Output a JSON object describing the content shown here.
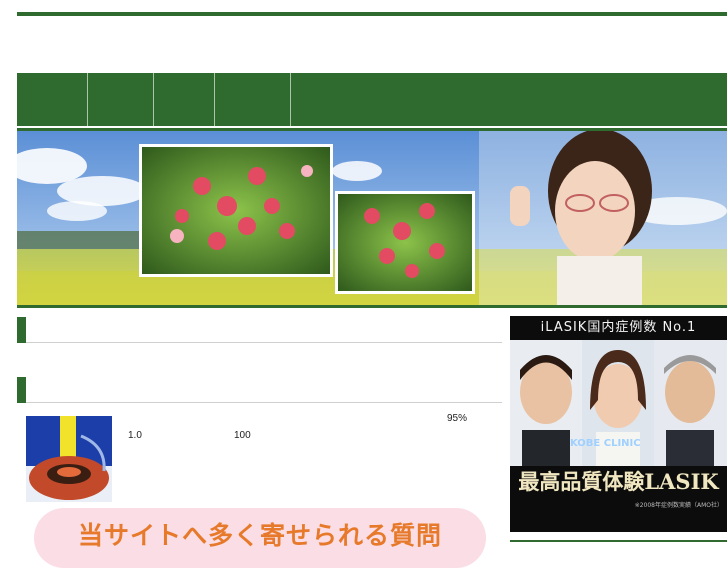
{
  "stats": {
    "vision": "1.0",
    "count": "100",
    "rate": "95%"
  },
  "ad": {
    "headline": "iLASIK国内症例数 No.1",
    "clinic_logo": "KOBE CLINIC",
    "tagline": "最高品質体験LASIK",
    "note": "※2008年症例数実績（AMO社）"
  },
  "faq_banner": {
    "label": "当サイトへ多く寄せられる質問"
  },
  "colors": {
    "brand_green": "#2f6b2f",
    "faq_orange": "#e77a2a",
    "faq_pink": "#fbdde6"
  },
  "icons": {
    "eye": "eye-diagram-icon"
  }
}
